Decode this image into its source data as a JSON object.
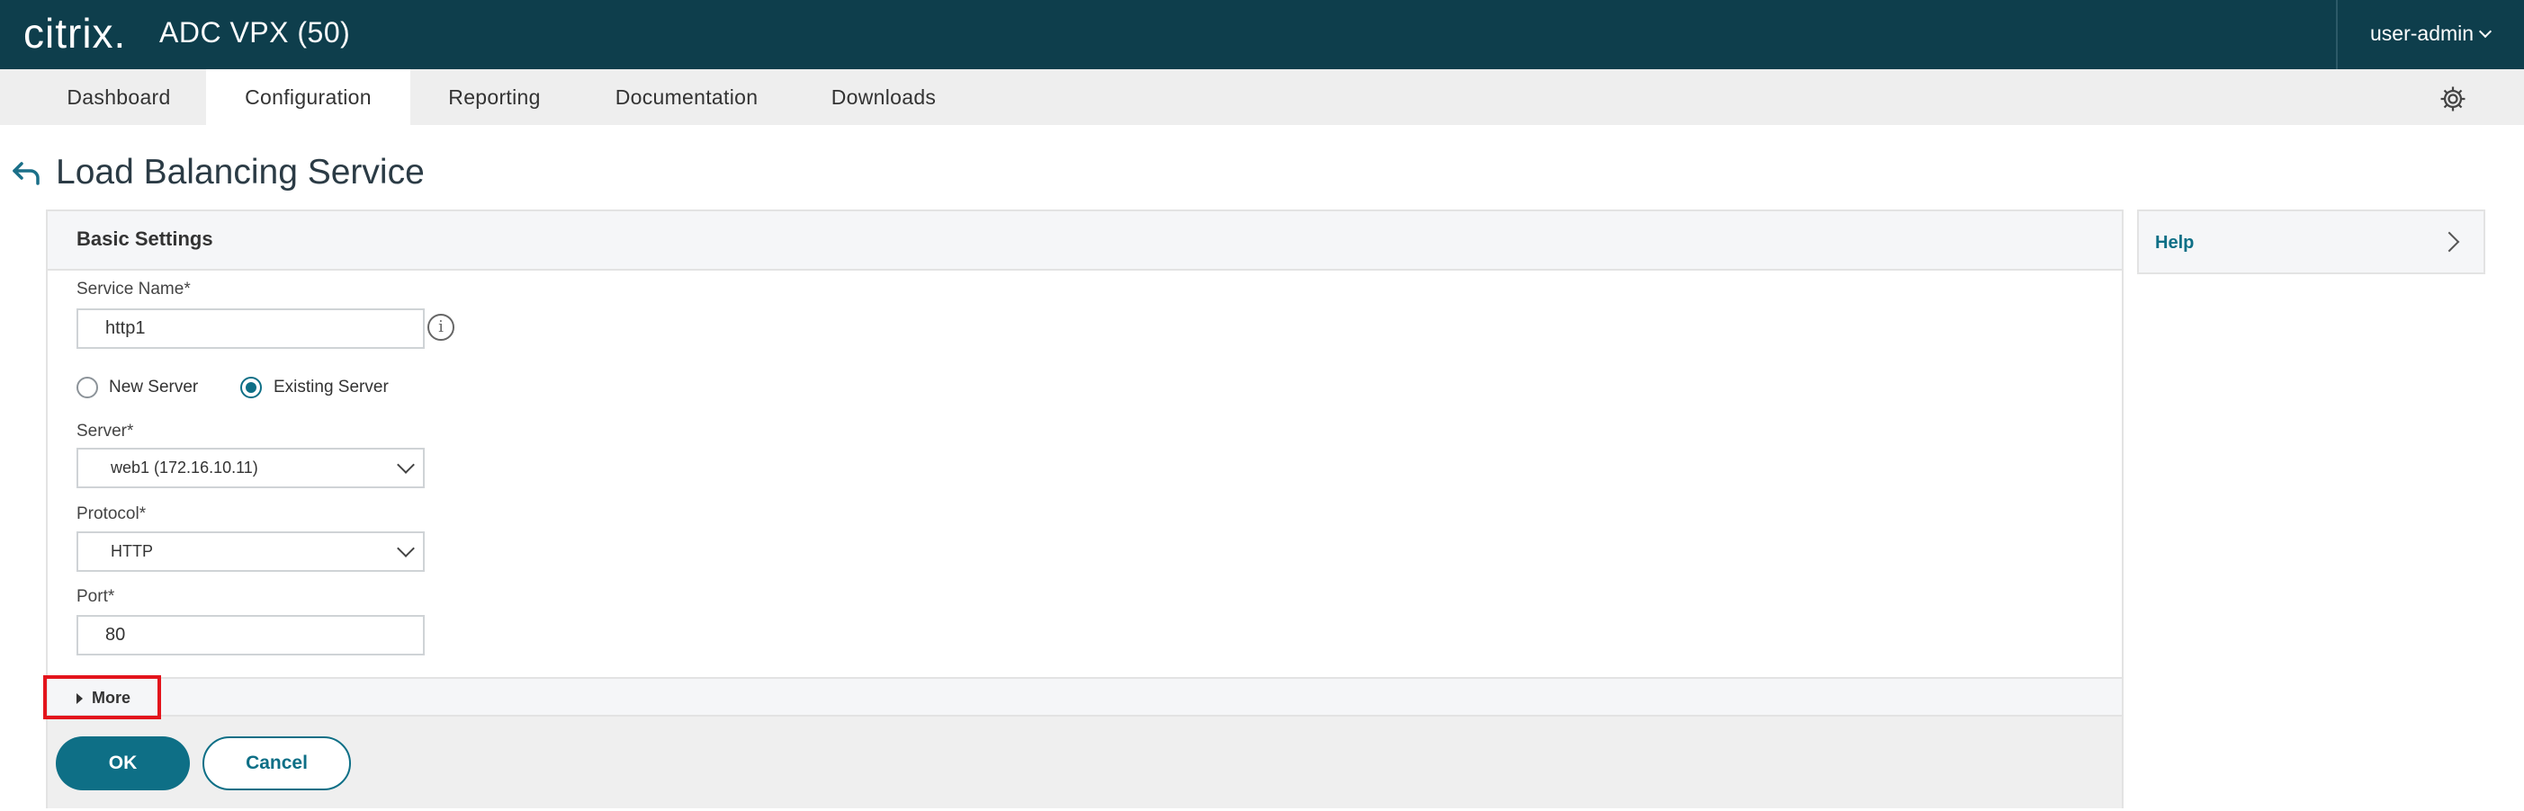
{
  "header": {
    "logo_text": "citrix.",
    "app_title": "ADC VPX (50)",
    "user_label": "user-admin",
    "background_color": "#0e3e4c"
  },
  "nav": {
    "tabs": [
      {
        "label": "Dashboard",
        "active": false
      },
      {
        "label": "Configuration",
        "active": true
      },
      {
        "label": "Reporting",
        "active": false
      },
      {
        "label": "Documentation",
        "active": false
      },
      {
        "label": "Downloads",
        "active": false
      }
    ],
    "settings_icon": "gear-icon"
  },
  "page": {
    "title": "Load Balancing Service",
    "back_icon": "back-arrow-icon"
  },
  "form": {
    "section_title": "Basic Settings",
    "service_name": {
      "label": "Service Name*",
      "value": "http1"
    },
    "server_type": {
      "options": [
        {
          "label": "New Server",
          "checked": false
        },
        {
          "label": "Existing Server",
          "checked": true
        }
      ]
    },
    "server": {
      "label": "Server*",
      "value": "web1 (172.16.10.11)"
    },
    "protocol": {
      "label": "Protocol*",
      "value": "HTTP"
    },
    "port": {
      "label": "Port*",
      "value": "80"
    },
    "more_label": "More",
    "ok_label": "OK",
    "cancel_label": "Cancel",
    "accent_color": "#0e6f86",
    "highlight_color": "#e3141c"
  },
  "help": {
    "label": "Help"
  }
}
